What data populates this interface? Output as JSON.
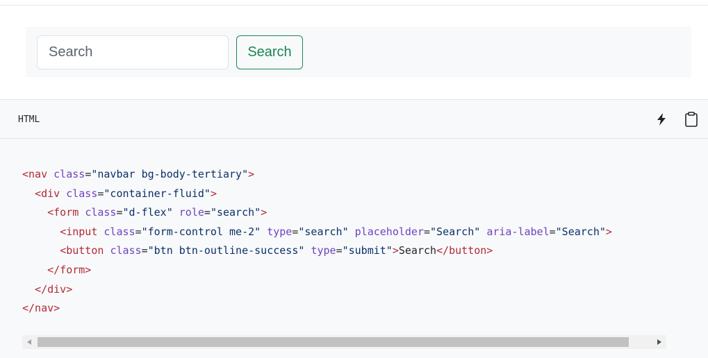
{
  "example": {
    "search_placeholder": "Search",
    "search_aria_label": "Search",
    "search_button_label": "Search"
  },
  "code_panel": {
    "language": "HTML",
    "run_icon": "lightning-bolt-icon",
    "copy_icon": "clipboard-icon",
    "lines": [
      {
        "indent": "",
        "parts": [
          {
            "t": "tag",
            "v": "<nav"
          },
          {
            "t": "punct",
            "v": " "
          },
          {
            "t": "attr",
            "v": "class"
          },
          {
            "t": "punct",
            "v": "="
          },
          {
            "t": "str",
            "v": "\"navbar bg-body-tertiary\""
          },
          {
            "t": "tag",
            "v": ">"
          }
        ]
      },
      {
        "indent": "  ",
        "parts": [
          {
            "t": "tag",
            "v": "<div"
          },
          {
            "t": "punct",
            "v": " "
          },
          {
            "t": "attr",
            "v": "class"
          },
          {
            "t": "punct",
            "v": "="
          },
          {
            "t": "str",
            "v": "\"container-fluid\""
          },
          {
            "t": "tag",
            "v": ">"
          }
        ]
      },
      {
        "indent": "    ",
        "parts": [
          {
            "t": "tag",
            "v": "<form"
          },
          {
            "t": "punct",
            "v": " "
          },
          {
            "t": "attr",
            "v": "class"
          },
          {
            "t": "punct",
            "v": "="
          },
          {
            "t": "str",
            "v": "\"d-flex\""
          },
          {
            "t": "punct",
            "v": " "
          },
          {
            "t": "attr",
            "v": "role"
          },
          {
            "t": "punct",
            "v": "="
          },
          {
            "t": "str",
            "v": "\"search\""
          },
          {
            "t": "tag",
            "v": ">"
          }
        ]
      },
      {
        "indent": "      ",
        "parts": [
          {
            "t": "tag",
            "v": "<input"
          },
          {
            "t": "punct",
            "v": " "
          },
          {
            "t": "attr",
            "v": "class"
          },
          {
            "t": "punct",
            "v": "="
          },
          {
            "t": "str",
            "v": "\"form-control me-2\""
          },
          {
            "t": "punct",
            "v": " "
          },
          {
            "t": "attr",
            "v": "type"
          },
          {
            "t": "punct",
            "v": "="
          },
          {
            "t": "str",
            "v": "\"search\""
          },
          {
            "t": "punct",
            "v": " "
          },
          {
            "t": "attr",
            "v": "placeholder"
          },
          {
            "t": "punct",
            "v": "="
          },
          {
            "t": "str",
            "v": "\"Search\""
          },
          {
            "t": "punct",
            "v": " "
          },
          {
            "t": "attr",
            "v": "aria-label"
          },
          {
            "t": "punct",
            "v": "="
          },
          {
            "t": "str",
            "v": "\"Search\""
          },
          {
            "t": "tag",
            "v": ">"
          }
        ]
      },
      {
        "indent": "      ",
        "parts": [
          {
            "t": "tag",
            "v": "<button"
          },
          {
            "t": "punct",
            "v": " "
          },
          {
            "t": "attr",
            "v": "class"
          },
          {
            "t": "punct",
            "v": "="
          },
          {
            "t": "str",
            "v": "\"btn btn-outline-success\""
          },
          {
            "t": "punct",
            "v": " "
          },
          {
            "t": "attr",
            "v": "type"
          },
          {
            "t": "punct",
            "v": "="
          },
          {
            "t": "str",
            "v": "\"submit\""
          },
          {
            "t": "tag",
            "v": ">"
          },
          {
            "t": "punct",
            "v": "Search"
          },
          {
            "t": "tag",
            "v": "</button>"
          }
        ]
      },
      {
        "indent": "    ",
        "parts": [
          {
            "t": "tag",
            "v": "</form>"
          }
        ]
      },
      {
        "indent": "  ",
        "parts": [
          {
            "t": "tag",
            "v": "</div>"
          }
        ]
      },
      {
        "indent": "",
        "parts": [
          {
            "t": "tag",
            "v": "</nav>"
          }
        ]
      }
    ]
  },
  "colors": {
    "success": "#198754",
    "code_tag": "#b02a37",
    "code_attr": "#6f42c1",
    "code_string": "#0a3069",
    "panel_bg": "#f8f9fa",
    "border": "#dee2e6"
  },
  "icons": {
    "scroll_left": "triangle-left-icon",
    "scroll_right": "triangle-right-icon"
  }
}
